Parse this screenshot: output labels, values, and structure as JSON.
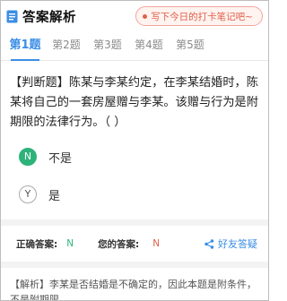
{
  "header": {
    "title": "答案解析",
    "banner": "写下今日的打卡笔记吧~"
  },
  "tabs": [
    {
      "label": "第1题",
      "active": true
    },
    {
      "label": "第2题",
      "active": false
    },
    {
      "label": "第3题",
      "active": false
    },
    {
      "label": "第4题",
      "active": false
    },
    {
      "label": "第5题",
      "active": false
    }
  ],
  "question": {
    "text": "【判断题】陈某与李某约定，在李某结婚时，陈某将自己的一套房屋赠与李某。该赠与行为是附期限的法律行为。（    ）"
  },
  "options": [
    {
      "letter": "N",
      "text": "不是",
      "correct": true
    },
    {
      "letter": "Y",
      "text": "是",
      "correct": false
    }
  ],
  "answer": {
    "correct_label": "正确答案:",
    "correct_value": "N",
    "mine_label": "您的答案:",
    "mine_value": "N",
    "ask_label": "好友答疑"
  },
  "analysis": {
    "text": "【解析】李某是否结婚是不确定的，因此本题是附条件，不是附期限。"
  },
  "colors": {
    "accent": "#3a8ee6",
    "correct": "#2db37a",
    "mine": "#e0604a"
  }
}
